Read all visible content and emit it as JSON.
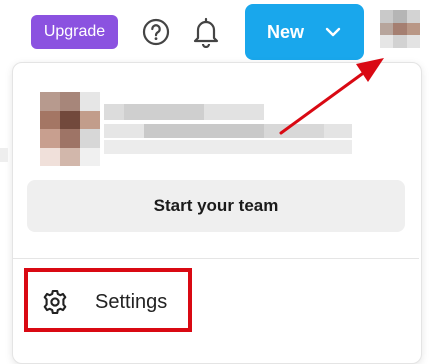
{
  "topbar": {
    "upgrade_label": "Upgrade",
    "new_label": "New",
    "icons": [
      "help-icon",
      "bell-icon",
      "chevron-down-icon"
    ]
  },
  "menu": {
    "start_team_label": "Start your team",
    "settings_label": "Settings"
  },
  "colors": {
    "upgrade_bg": "#8b52e0",
    "new_bg": "#19a7ec",
    "annotation_red": "#d90913",
    "button_gray": "#efefef"
  }
}
